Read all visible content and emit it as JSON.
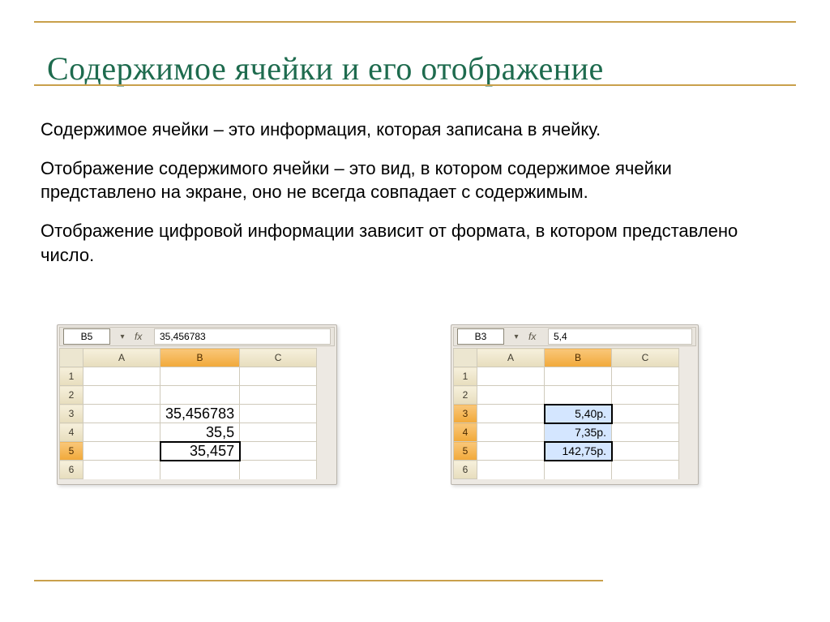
{
  "title": "Содержимое ячейки и его отображение",
  "paragraphs": {
    "p1": "Содержимое ячейки – это информация, которая записана в ячейку.",
    "p2": "Отображение содержимого ячейки – это вид, в котором содержимое ячейки представлено на экране, оно не всегда совпадает с содержимым.",
    "p3": "Отображение цифровой информации зависит от формата,  в котором представлено число."
  },
  "sheet1": {
    "name_box": "B5",
    "fx": "fx",
    "formula_value": "35,456783",
    "cols": {
      "a": "A",
      "b": "B",
      "c": "C"
    },
    "rows": [
      "1",
      "2",
      "3",
      "4",
      "5",
      "6"
    ],
    "active_row": "5",
    "active_col": "b",
    "cells": {
      "b3": "35,456783",
      "b4": "35,5",
      "b5": "35,457"
    }
  },
  "sheet2": {
    "name_box": "B3",
    "fx": "fx",
    "formula_value": "5,4",
    "cols": {
      "a": "A",
      "b": "B",
      "c": "C"
    },
    "rows": [
      "1",
      "2",
      "3",
      "4",
      "5",
      "6"
    ],
    "active_row": "3",
    "active_col": "b",
    "selected_rows": [
      "3",
      "4",
      "5"
    ],
    "cells": {
      "b3": "5,40р.",
      "b4": "7,35р.",
      "b5": "142,75р."
    }
  }
}
